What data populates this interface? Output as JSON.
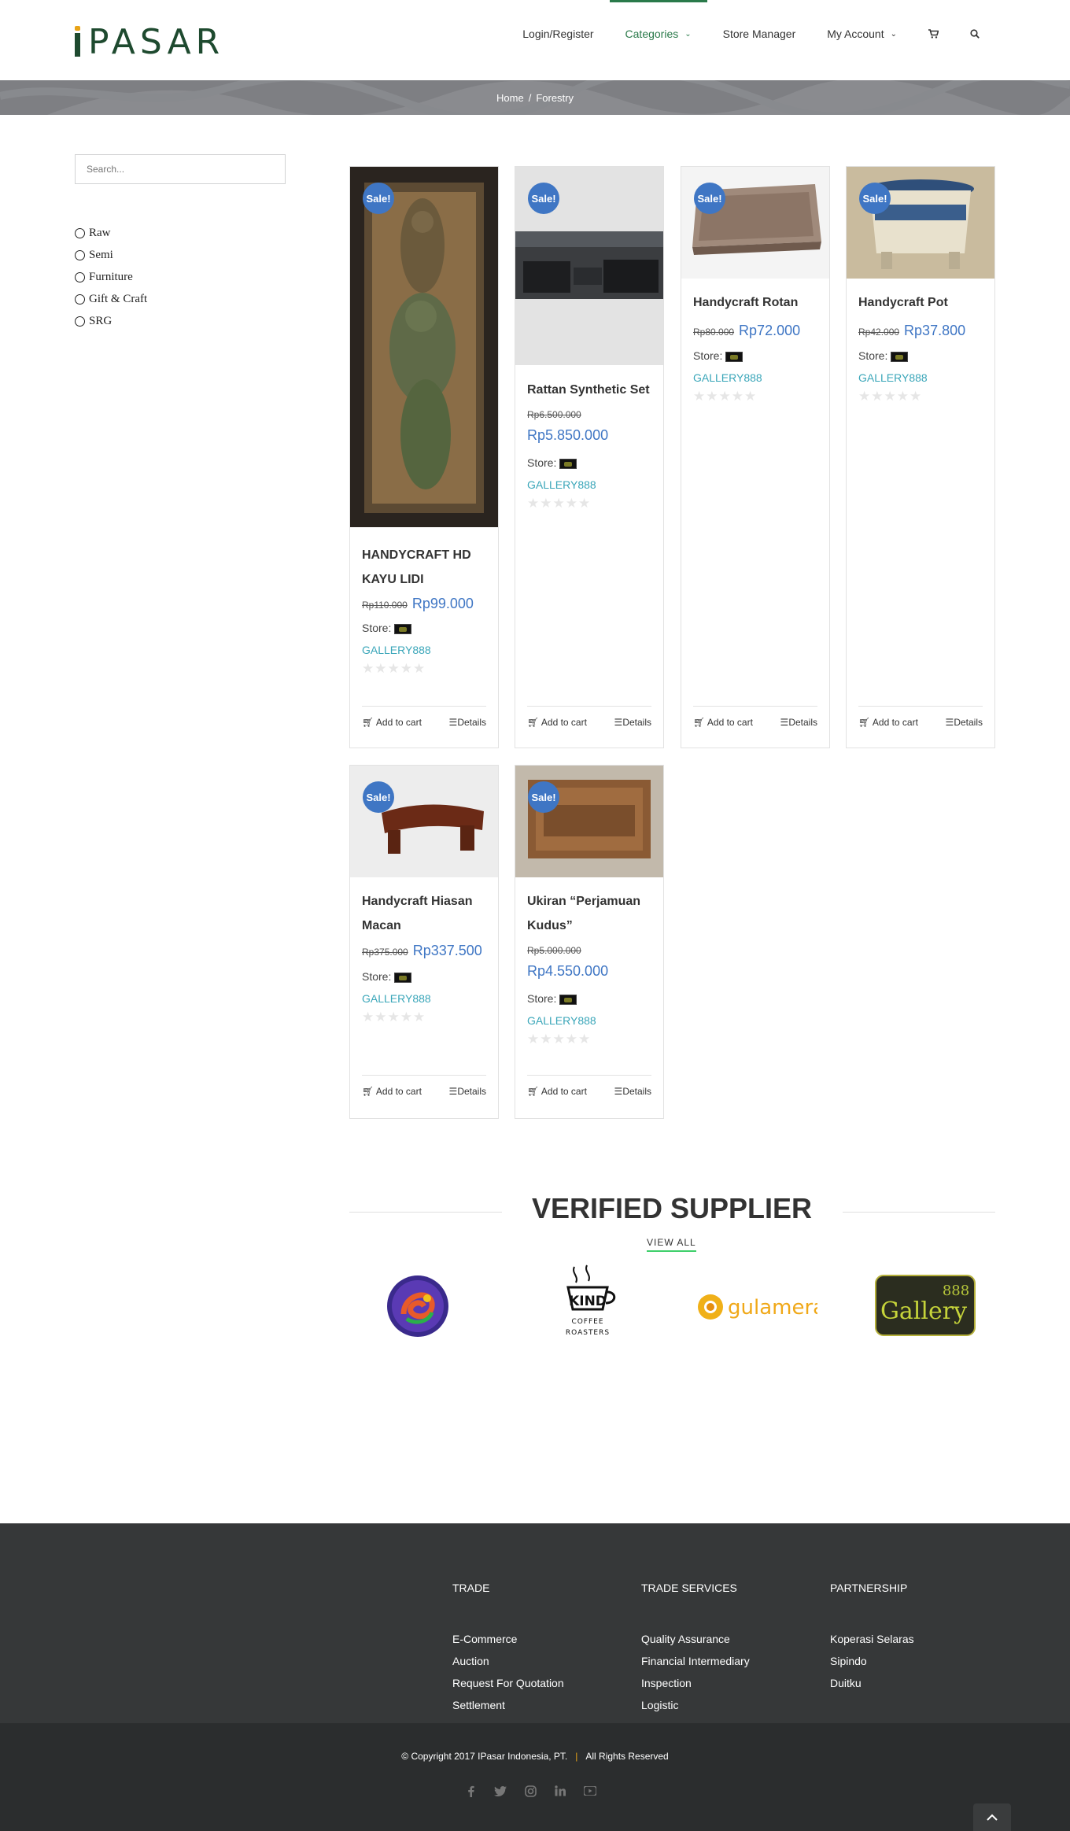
{
  "header": {
    "logo_text": "PASAR",
    "nav": {
      "login": "Login/Register",
      "categories": "Categories",
      "store_manager": "Store Manager",
      "my_account": "My Account"
    }
  },
  "breadcrumb": {
    "home": "Home",
    "separator": "/",
    "current": "Forestry"
  },
  "sidebar": {
    "search_placeholder": "Search...",
    "filters": [
      "Raw",
      "Semi",
      "Furniture",
      "Gift & Craft",
      "SRG"
    ]
  },
  "products": [
    {
      "sale": "Sale!",
      "title": "HANDYCRAFT HD KAYU LIDI",
      "old_price": "Rp110.000",
      "price": "Rp99.000",
      "store_label": "Store:",
      "store_name": "GALLERY888",
      "add_to_cart": "Add to cart",
      "details": "Details"
    },
    {
      "sale": "Sale!",
      "title": "Rattan Synthetic Set",
      "old_price": "Rp6.500.000",
      "price": "Rp5.850.000",
      "store_label": "Store:",
      "store_name": "GALLERY888",
      "add_to_cart": "Add to cart",
      "details": "Details"
    },
    {
      "sale": "Sale!",
      "title": "Handycraft Rotan",
      "old_price": "Rp80.000",
      "price": "Rp72.000",
      "store_label": "Store:",
      "store_name": "GALLERY888",
      "add_to_cart": "Add to cart",
      "details": "Details"
    },
    {
      "sale": "Sale!",
      "title": "Handycraft Pot",
      "old_price": "Rp42.000",
      "price": "Rp37.800",
      "store_label": "Store:",
      "store_name": "GALLERY888",
      "add_to_cart": "Add to cart",
      "details": "Details"
    },
    {
      "sale": "Sale!",
      "title": "Handycraft Hiasan Macan",
      "old_price": "Rp375.000",
      "price": "Rp337.500",
      "store_label": "Store:",
      "store_name": "GALLERY888",
      "add_to_cart": "Add to cart",
      "details": "Details"
    },
    {
      "sale": "Sale!",
      "title": "Ukiran “Perjamuan Kudus”",
      "old_price": "Rp5.000.000",
      "price": "Rp4.550.000",
      "store_label": "Store:",
      "store_name": "GALLERY888",
      "add_to_cart": "Add to cart",
      "details": "Details"
    }
  ],
  "supplier": {
    "title": "VERIFIED SUPPLIER",
    "view_all": "VIEW ALL",
    "logos": {
      "kind_line1": "COFFEE",
      "kind_line2": "ROASTERS",
      "kind_mark": "KIND",
      "gulamera": "gulamera",
      "gallery": "Gallery",
      "gallery_num": "888"
    }
  },
  "footer": {
    "columns": [
      {
        "heading": "TRADE",
        "links": [
          "E-Commerce",
          "Auction",
          "Request For Quotation",
          "Settlement"
        ]
      },
      {
        "heading": "TRADE SERVICES",
        "links": [
          "Quality Assurance",
          "Financial Intermediary",
          "Inspection",
          "Logistic"
        ]
      },
      {
        "heading": "PARTNERSHIP",
        "links": [
          "Koperasi Selaras",
          "Sipindo",
          "Duitku"
        ]
      }
    ],
    "copyright": "© Copyright 2017 IPasar Indonesia, PT.",
    "separator": "|",
    "rights": "All Rights Reserved"
  },
  "colors": {
    "brand_green": "#1e4a2f",
    "accent_yellow": "#e8a317",
    "sale_blue": "#3f76c4",
    "store_link": "#3aa6b9"
  }
}
